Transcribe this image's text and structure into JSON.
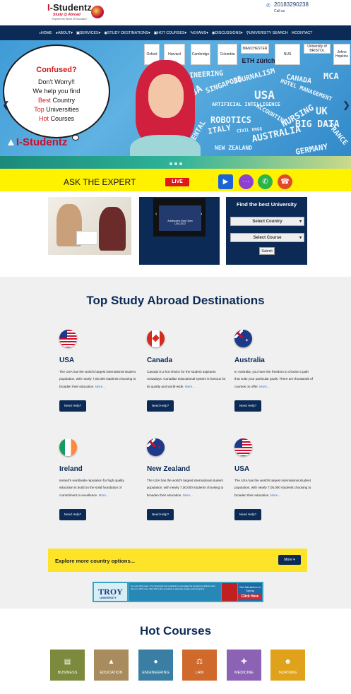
{
  "header": {
    "logo_text": "I-Studentz",
    "logo_sub": "Study @ Abroad",
    "logo_tag": "\"Explore the World of Education\"",
    "phone": "20183290238",
    "callus": "Call us"
  },
  "nav": {
    "items": [
      "HOME",
      "ABOUT",
      "SERVICES",
      "STUDY DESTINATIONS",
      "HOT COURSES",
      "EXAMS",
      "DISCUSSIONS",
      "UNIVERSITY SEARCH",
      "CONTACT"
    ]
  },
  "banner": {
    "confused": "Confused?",
    "line1": "Don't Worry!!",
    "line2": "We help you find",
    "line3a": "Best",
    "line3b": " Country",
    "line4a": "Top",
    "line4b": " Universities",
    "line5a": "Hot",
    "line5b": " Courses",
    "logo": "I-Studentz",
    "universities": [
      "Oxford",
      "Harvard",
      "Cambridge",
      "Columbia",
      "MANCHESTER",
      "NUS",
      "University of BRISTOL",
      "Johns Hopkins",
      "ETH zürich"
    ],
    "words": [
      "ENGINEERING",
      "MBA",
      "SINGAPORE",
      "JOURNALISM",
      "CANADA",
      "USA",
      "HOTEL MANAGEMENT",
      "MCA",
      "ARTIFICIAL INTELLIGENCE",
      "ROBOTICS",
      "ACCOUNTING",
      "NURSING",
      "UK",
      "BIG DATA",
      "ITALY",
      "AUSTRALIA",
      "DENTAL",
      "NEW ZEALAND",
      "FRANCE",
      "GERMANY",
      "CIVIL ENGG"
    ]
  },
  "ask": {
    "title": "ASK THE EXPERT",
    "live": "LIVE"
  },
  "video": {
    "caption": "Admissions Now Open USA 2022"
  },
  "finder": {
    "title": "Find the best University",
    "country": "Select Country",
    "course": "Select Course",
    "submit": "Submit"
  },
  "destinations": {
    "title": "Top Study Abroad Destinations",
    "help_label": "Need Help?",
    "more_label": "More...",
    "cards": [
      {
        "name": "USA",
        "desc": "The USA has the world's largest international student population, with nearly 7,00,000 students choosing to broaden their education."
      },
      {
        "name": "Canada",
        "desc": "Canada is a hot-choice for the student aspirants nowadays. Canadian Educational system is famous for its quality and world-wide."
      },
      {
        "name": "Australia",
        "desc": "In Australia, you have the freedom to choose a path that suits your particular goals. There are thousands of courses on offer."
      },
      {
        "name": "Ireland",
        "desc": "Ireland's worldwide reputation for high quality education is build on the solid foundation of commitment to excellence."
      },
      {
        "name": "New Zealand",
        "desc": "The USA has the world's largest international student population, with nearly 7,00,000 students choosing to broaden their education."
      },
      {
        "name": "USA",
        "desc": "The USA has the world's largest international student population, with nearly 7,00,000 students choosing to broaden their education."
      }
    ],
    "explore": "Explore more country options...",
    "explore_btn": "More"
  },
  "ad": {
    "brand": "TROY",
    "brand_sub": "UNIVERSITY",
    "cta_top": "Get Admission in Spring",
    "cta": "Click Here",
    "blurb": "For over 130 years, Troy University has enabled & encouraged its students to deliver what they do. With more than 200 online graduate & graduate degree and programs."
  },
  "courses": {
    "title": "Hot Courses",
    "items": [
      {
        "label": "BUSINESS",
        "color": "#7b8a3c"
      },
      {
        "label": "EDUCATION",
        "color": "#a88c5e"
      },
      {
        "label": "ENGINEERING",
        "color": "#3a7fa3"
      },
      {
        "label": "LAW",
        "color": "#cf6a2c"
      },
      {
        "label": "MEDICINE",
        "color": "#8c62b5"
      },
      {
        "label": "NURSING",
        "color": "#e0a21a"
      }
    ]
  },
  "colors": {
    "navy": "#0b2a55",
    "yellow": "#fff200",
    "red": "#c8102e"
  }
}
